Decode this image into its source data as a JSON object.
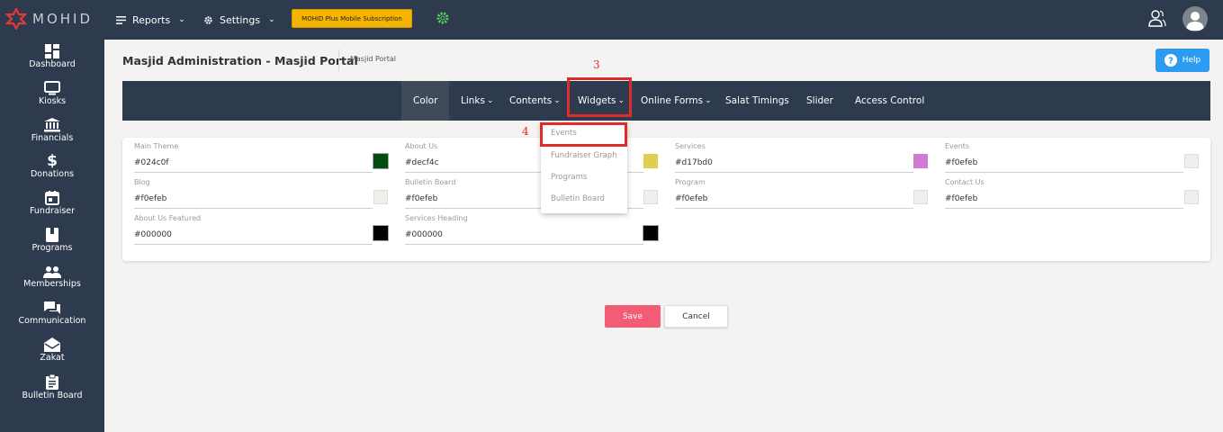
{
  "topbar": {
    "logo_text": "MOHID",
    "reports_label": "Reports",
    "settings_label": "Settings",
    "subscription_label": "MOHID Plus Mobile Subscription"
  },
  "sidebar": {
    "items": [
      {
        "label": "Dashboard",
        "icon": "dashboard-icon"
      },
      {
        "label": "Kiosks",
        "icon": "kiosk-icon"
      },
      {
        "label": "Financials",
        "icon": "bank-icon"
      },
      {
        "label": "Donations",
        "icon": "dollar-icon"
      },
      {
        "label": "Fundraiser",
        "icon": "calendar-icon"
      },
      {
        "label": "Programs",
        "icon": "book-icon"
      },
      {
        "label": "Memberships",
        "icon": "people-icon"
      },
      {
        "label": "Communication",
        "icon": "chat-icon"
      },
      {
        "label": "Zakat",
        "icon": "envelope-icon"
      },
      {
        "label": "Bulletin Board",
        "icon": "clipboard-icon"
      }
    ]
  },
  "header": {
    "title": "Masjid Administration - Masjid Portal",
    "breadcrumb": "Masjid Portal",
    "help_label": "Help"
  },
  "tabs": [
    {
      "label": "Color",
      "active": true
    },
    {
      "label": "Links",
      "dropdown": true
    },
    {
      "label": "Contents",
      "dropdown": true
    },
    {
      "label": "Widgets",
      "dropdown": true
    },
    {
      "label": "Online Forms",
      "dropdown": true
    },
    {
      "label": "Salat Timings"
    },
    {
      "label": "Slider"
    },
    {
      "label": "Access Control"
    }
  ],
  "annotations": {
    "step3": "3",
    "step4": "4"
  },
  "widgets_menu": [
    "Events",
    "Fundraiser Graph",
    "Programs",
    "Bulletin Board"
  ],
  "colors": {
    "main_theme": {
      "label": "Main Theme",
      "value": "#024c0f"
    },
    "about_us": {
      "label": "About Us",
      "value": "#decf4c"
    },
    "services": {
      "label": "Services",
      "value": "#d17bd0"
    },
    "events": {
      "label": "Events",
      "value": "#f0efeb"
    },
    "blog": {
      "label": "Blog",
      "value": "#f0efeb"
    },
    "bulletin_board": {
      "label": "Bulletin Board",
      "value": "#f0efeb"
    },
    "program": {
      "label": "Program",
      "value": "#f0efeb"
    },
    "contact_us": {
      "label": "Contact Us",
      "value": "#f0efeb"
    },
    "about_us_featured": {
      "label": "About Us Featured",
      "value": "#000000"
    },
    "services_heading": {
      "label": "Services Heading",
      "value": "#000000"
    }
  },
  "actions": {
    "save_label": "Save",
    "cancel_label": "Cancel"
  },
  "theme": {
    "nav_bg": "#2e3b4e",
    "accent_red": "#e02b2b",
    "save_color": "#f25c75",
    "help_color": "#2d9cf0"
  }
}
